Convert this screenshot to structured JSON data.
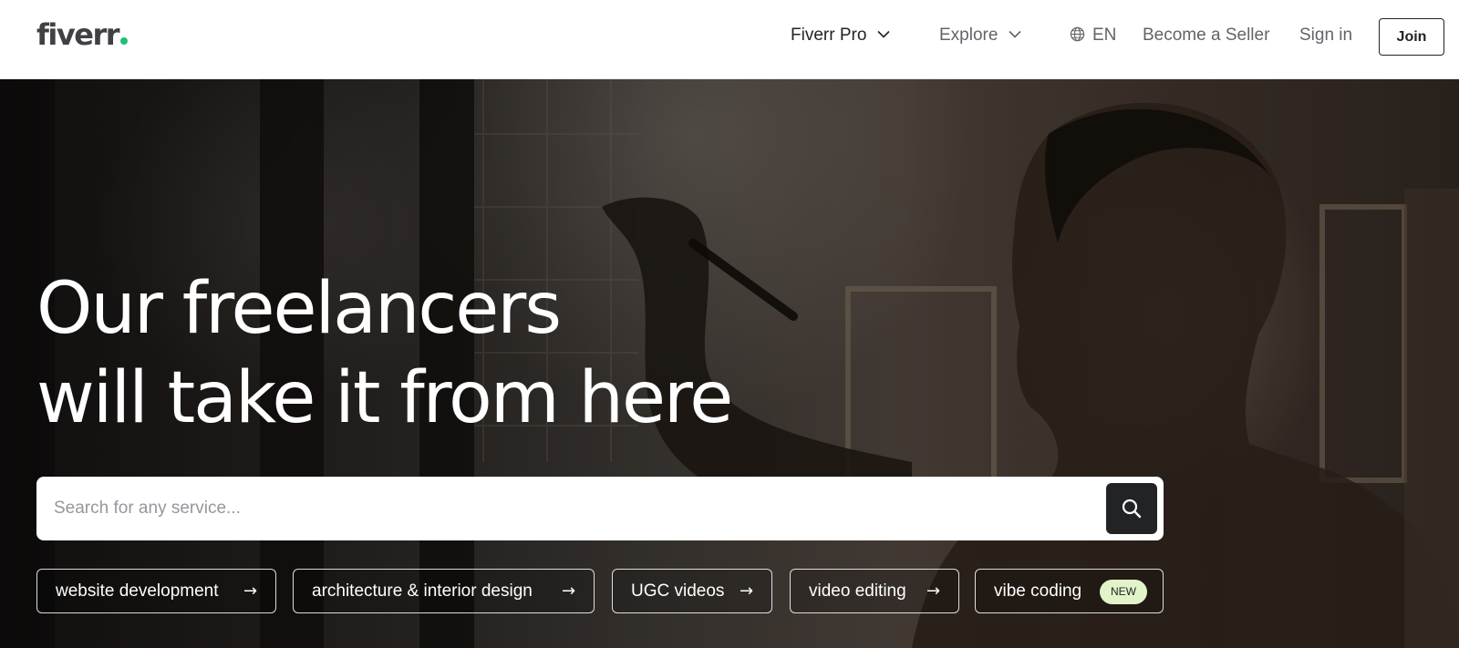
{
  "header": {
    "logo_text": "fiverr",
    "brand_color": "#1dbf73",
    "nav": {
      "fiverr_pro": "Fiverr Pro",
      "explore": "Explore",
      "language": "EN",
      "become_seller": "Become a Seller",
      "sign_in": "Sign in",
      "join": "Join"
    }
  },
  "hero": {
    "headline_line1": "Our freelancers",
    "headline_line2": "will take it from here",
    "search": {
      "placeholder": "Search for any service...",
      "value": ""
    },
    "chips": [
      {
        "label": "website development",
        "icon": "arrow-right-icon"
      },
      {
        "label": "architecture & interior design",
        "icon": "arrow-right-icon"
      },
      {
        "label": "UGC videos",
        "icon": "arrow-right-icon"
      },
      {
        "label": "video editing",
        "icon": "arrow-right-icon"
      },
      {
        "label": "vibe coding",
        "badge": "NEW"
      }
    ]
  },
  "icons": {
    "chevron": "chevron-down-icon",
    "globe": "globe-icon",
    "search": "search-icon"
  }
}
